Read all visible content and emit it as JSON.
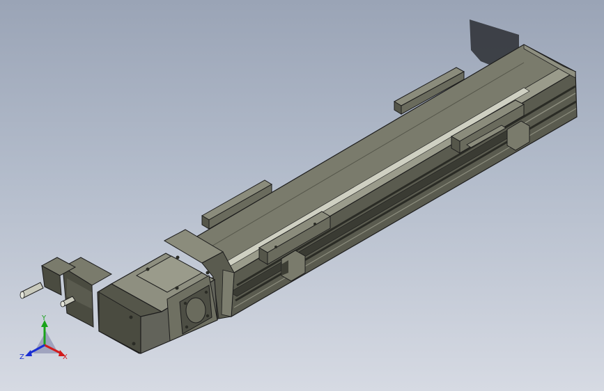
{
  "triad": {
    "x_label": "X",
    "y_label": "Y",
    "z_label": "Z",
    "colors": {
      "x": "#d21b1b",
      "y": "#1aa31a",
      "z": "#1b2fd2"
    }
  },
  "model": {
    "body_color": "#6f7062",
    "edge_color": "#1c1c1c"
  }
}
